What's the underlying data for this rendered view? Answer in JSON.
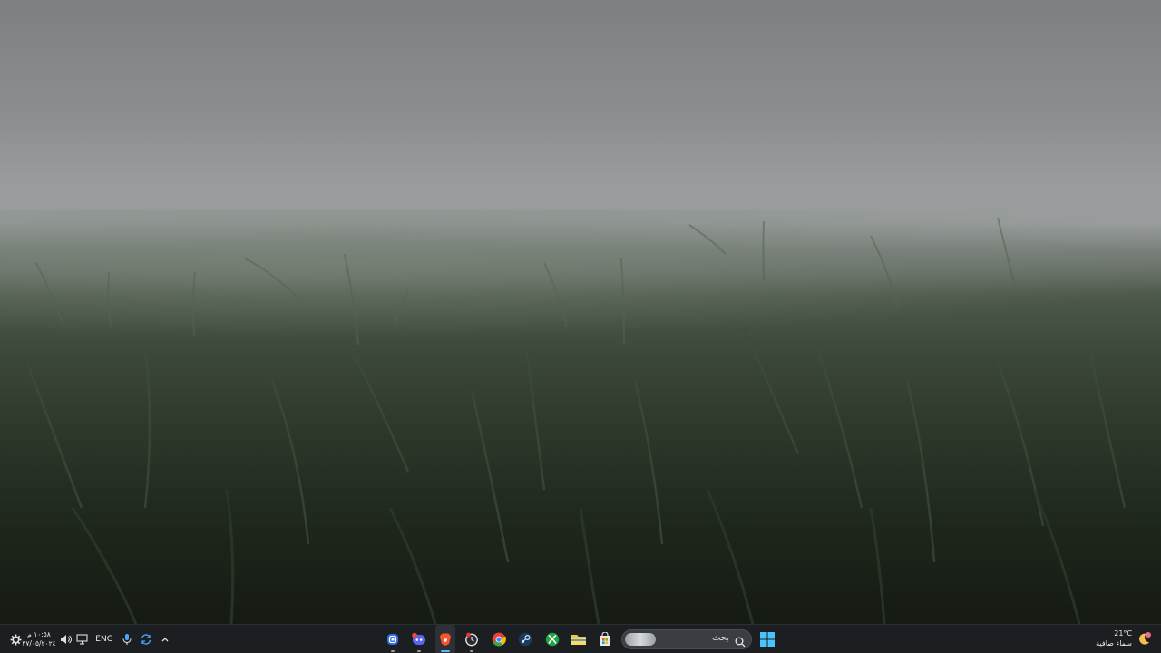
{
  "desktop": {
    "wallpaper": "misty grass field"
  },
  "taskbar": {
    "weather": {
      "temperature": "21°C",
      "condition": "سماء صافية",
      "icon": "moon-icon"
    },
    "start_icon": "windows-logo-icon",
    "search": {
      "placeholder": "بحث",
      "icon": "search-icon"
    },
    "pinned_apps": [
      {
        "name": "Microsoft Store",
        "icon": "store-icon"
      },
      {
        "name": "File Explorer",
        "icon": "folder-icon"
      },
      {
        "name": "Xbox",
        "icon": "xbox-icon"
      },
      {
        "name": "Steam",
        "icon": "steam-icon"
      },
      {
        "name": "Google Chrome",
        "icon": "chrome-icon"
      },
      {
        "name": "Clock app",
        "icon": "clock-icon"
      },
      {
        "name": "Brave",
        "icon": "brave-icon"
      },
      {
        "name": "Discord",
        "icon": "discord-icon"
      },
      {
        "name": "Copilot",
        "icon": "copilot-icon"
      }
    ],
    "tray": {
      "language": "ENG",
      "time": "١٠:٥٨ م",
      "date": "٢٧/٠٥/٢٠٢٤"
    },
    "colors": {
      "taskbar_bg": "#1c1f22",
      "accent": "#5fb2ff"
    }
  }
}
